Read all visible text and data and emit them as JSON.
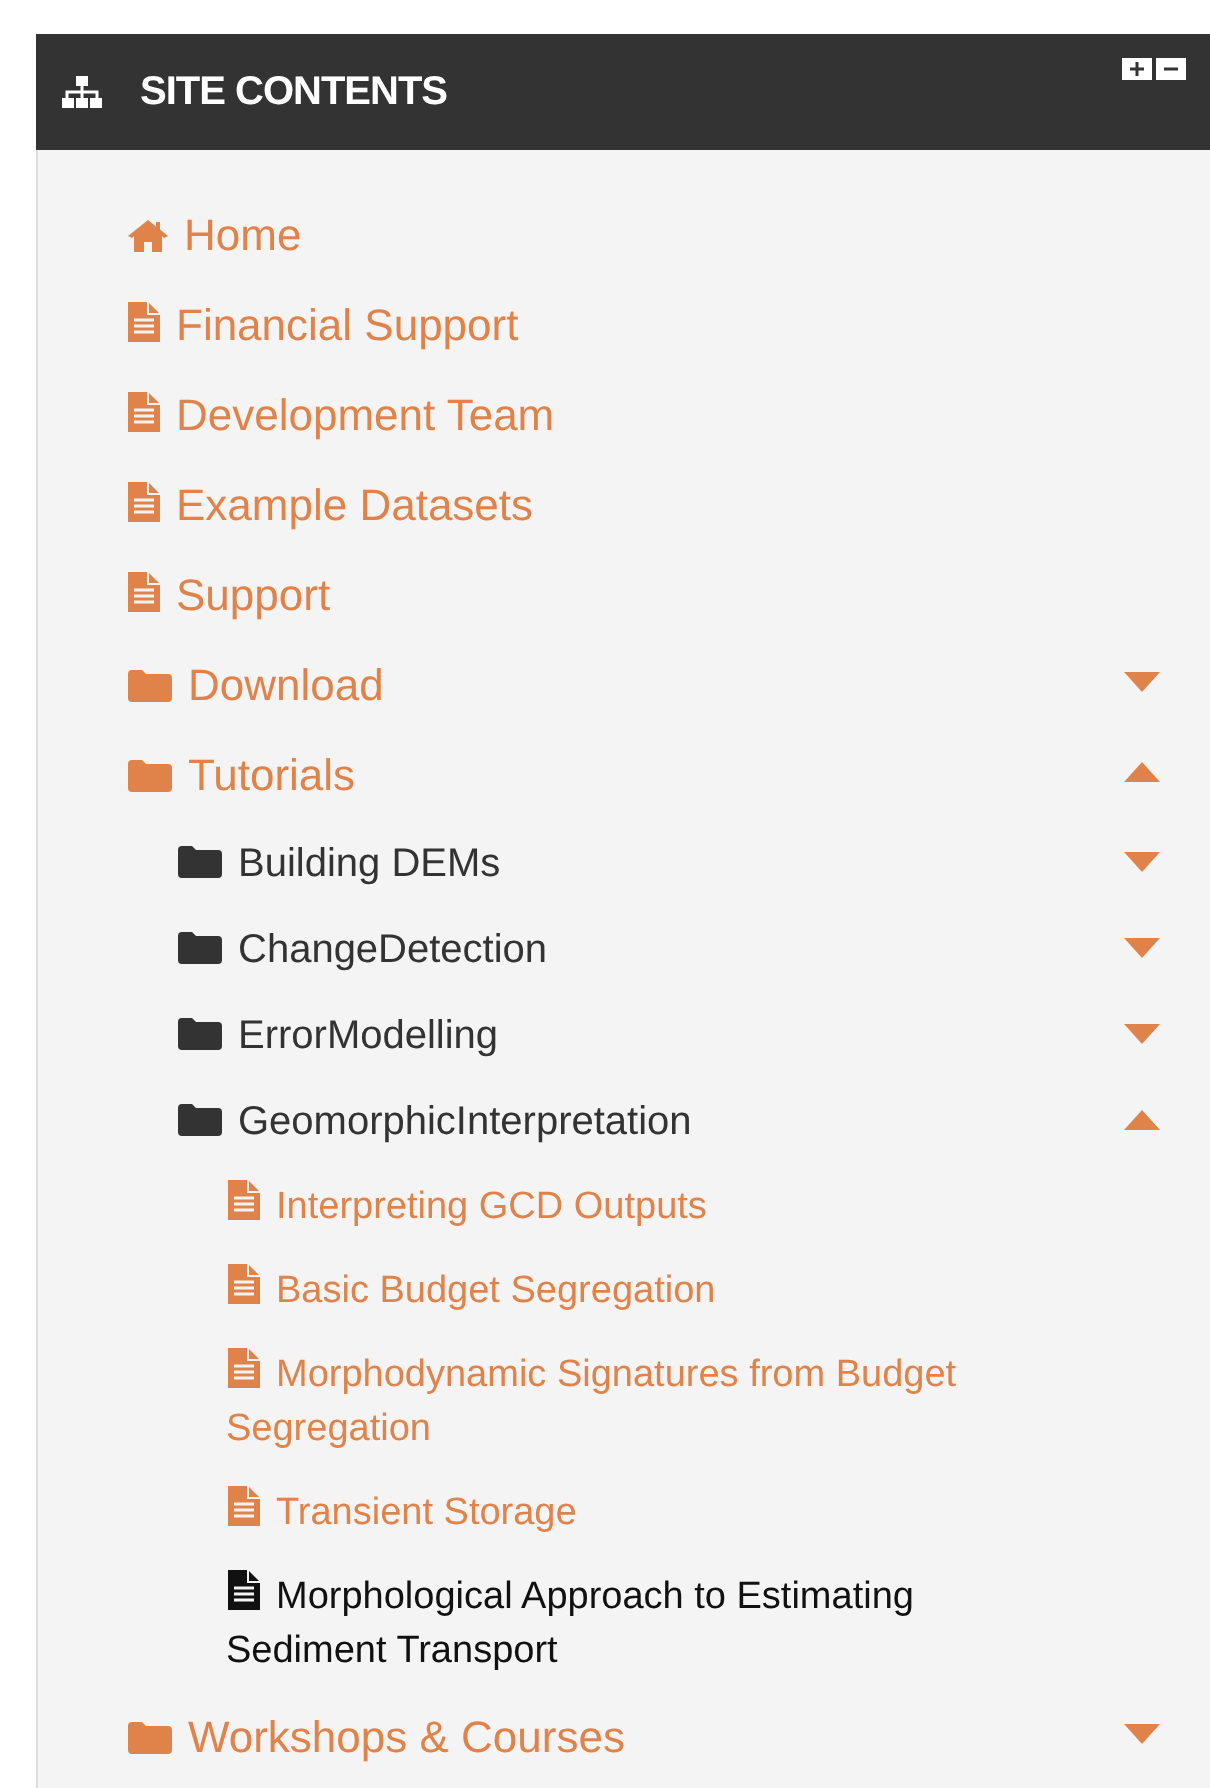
{
  "block": {
    "title": "SITE CONTENTS",
    "items": [
      {
        "kind": "home",
        "label": "Home",
        "selected": false
      },
      {
        "kind": "page",
        "label": "Financial Support",
        "selected": false
      },
      {
        "kind": "page",
        "label": "Development Team",
        "selected": false
      },
      {
        "kind": "page",
        "label": "Example Datasets",
        "selected": false
      },
      {
        "kind": "page",
        "label": "Support",
        "selected": false
      },
      {
        "kind": "folder",
        "label": "Download",
        "expanded": false,
        "selected": false
      },
      {
        "kind": "folder",
        "label": "Tutorials",
        "expanded": true,
        "selected": false,
        "children": [
          {
            "kind": "folder",
            "label": "Building DEMs",
            "expanded": false,
            "selected": false
          },
          {
            "kind": "folder",
            "label": "ChangeDetection",
            "expanded": false,
            "selected": false
          },
          {
            "kind": "folder",
            "label": "ErrorModelling",
            "expanded": false,
            "selected": false
          },
          {
            "kind": "folder",
            "label": "GeomorphicInterpretation",
            "expanded": true,
            "selected": false,
            "children": [
              {
                "kind": "page",
                "label": "Interpreting GCD Outputs",
                "selected": false
              },
              {
                "kind": "page",
                "label": "Basic Budget Segregation",
                "selected": false
              },
              {
                "kind": "page",
                "label": "Morphodynamic Signatures from Budget Segregation",
                "selected": false
              },
              {
                "kind": "page",
                "label": "Transient Storage",
                "selected": false
              },
              {
                "kind": "page",
                "label": "Morphological Approach to Estimating Sediment Transport",
                "selected": true
              }
            ]
          }
        ]
      },
      {
        "kind": "folder",
        "label": "Workshops & Courses",
        "expanded": false,
        "selected": false
      }
    ]
  }
}
